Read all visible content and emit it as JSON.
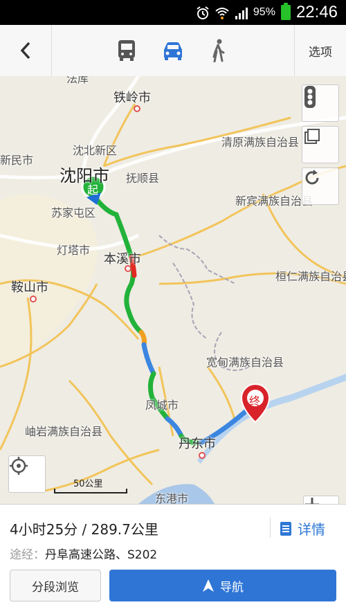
{
  "status_bar": {
    "battery_text": "95%",
    "time": "22:46"
  },
  "toolbar": {
    "options_label": "选项",
    "modes": [
      "bus-icon",
      "car-icon",
      "walk-icon"
    ],
    "active_mode": "car-icon"
  },
  "map": {
    "cities": {
      "faku": "法库",
      "tieling": "铁岭市",
      "shenbei": "沈北新区",
      "xinmin": "新民市",
      "shenyang": "沈阳市",
      "fushun": "抚顺县",
      "sujiatun": "苏家屯区",
      "dengta": "灯塔市",
      "benxi": "本溪市",
      "anshan": "鞍山市",
      "qingyuan": "清原满族自治县",
      "xinbin": "新宾满族自治县",
      "huanren": "桓仁满族自治县",
      "kuandian": "宽甸满族自治县",
      "fengcheng": "凤城市",
      "xiuyan": "岫岩满族自治县",
      "dandong": "丹东市",
      "donggang": "东港市"
    },
    "start_marker": "起",
    "end_marker": "终",
    "scale_label": "50公里"
  },
  "route": {
    "summary": "4小时25分 / 289.7公里",
    "via_label": "途经：",
    "via_value": "丹阜高速公路、S202",
    "detail_label": "详情",
    "segment_button": "分段浏览",
    "navigate_button": "导航"
  },
  "colors": {
    "accent": "#2f75d6",
    "route_green": "#22b23a",
    "route_blue": "#3b86e0"
  }
}
